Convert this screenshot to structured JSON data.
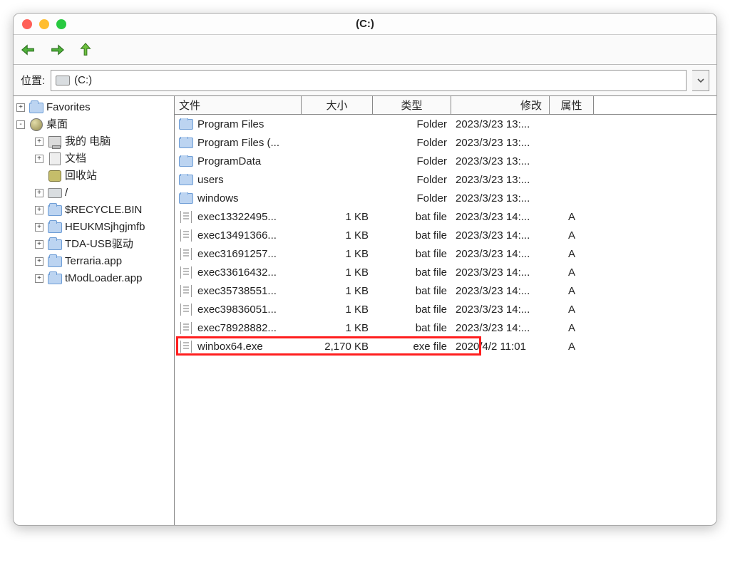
{
  "window": {
    "title": "(C:)"
  },
  "toolbar": {
    "back_icon": "arrow-left-icon",
    "forward_icon": "arrow-right-icon",
    "up_icon": "arrow-up-icon"
  },
  "location": {
    "label": "位置:",
    "path": "(C:)"
  },
  "tree": {
    "favorites": {
      "label": "Favorites",
      "expander": "+"
    },
    "desktop": {
      "label": "桌面",
      "expander": "-",
      "children": [
        {
          "kind": "pc",
          "label": "我的 电脑",
          "expander": "+"
        },
        {
          "kind": "doc",
          "label": "文档",
          "expander": "+"
        },
        {
          "kind": "bin",
          "label": "回收站",
          "expander": ""
        },
        {
          "kind": "drive",
          "label": "/",
          "expander": "+"
        },
        {
          "kind": "folder",
          "label": "$RECYCLE.BIN",
          "expander": "+"
        },
        {
          "kind": "folder",
          "label": "HEUKMSjhgjmfb",
          "expander": "+"
        },
        {
          "kind": "folder",
          "label": "TDA-USB驱动",
          "expander": "+"
        },
        {
          "kind": "folder",
          "label": "Terraria.app",
          "expander": "+"
        },
        {
          "kind": "folder",
          "label": "tModLoader.app",
          "expander": "+"
        }
      ]
    }
  },
  "columns": {
    "name": "文件",
    "size": "大小",
    "type": "类型",
    "mod": "修改",
    "attr": "属性"
  },
  "files": [
    {
      "icon": "folder",
      "name": "Program Files",
      "size": "",
      "type": "Folder",
      "mod": "2023/3/23 13:...",
      "attr": "",
      "hl": false
    },
    {
      "icon": "folder",
      "name": "Program Files (...",
      "size": "",
      "type": "Folder",
      "mod": "2023/3/23 13:...",
      "attr": "",
      "hl": false
    },
    {
      "icon": "folder",
      "name": "ProgramData",
      "size": "",
      "type": "Folder",
      "mod": "2023/3/23 13:...",
      "attr": "",
      "hl": false
    },
    {
      "icon": "folder",
      "name": "users",
      "size": "",
      "type": "Folder",
      "mod": "2023/3/23 13:...",
      "attr": "",
      "hl": false
    },
    {
      "icon": "folder",
      "name": "windows",
      "size": "",
      "type": "Folder",
      "mod": "2023/3/23 13:...",
      "attr": "",
      "hl": false
    },
    {
      "icon": "file",
      "name": "exec13322495...",
      "size": "1 KB",
      "type": "bat file",
      "mod": "2023/3/23 14:...",
      "attr": "A",
      "hl": false
    },
    {
      "icon": "file",
      "name": "exec13491366...",
      "size": "1 KB",
      "type": "bat file",
      "mod": "2023/3/23 14:...",
      "attr": "A",
      "hl": false
    },
    {
      "icon": "file",
      "name": "exec31691257...",
      "size": "1 KB",
      "type": "bat file",
      "mod": "2023/3/23 14:...",
      "attr": "A",
      "hl": false
    },
    {
      "icon": "file",
      "name": "exec33616432...",
      "size": "1 KB",
      "type": "bat file",
      "mod": "2023/3/23 14:...",
      "attr": "A",
      "hl": false
    },
    {
      "icon": "file",
      "name": "exec35738551...",
      "size": "1 KB",
      "type": "bat file",
      "mod": "2023/3/23 14:...",
      "attr": "A",
      "hl": false
    },
    {
      "icon": "file",
      "name": "exec39836051...",
      "size": "1 KB",
      "type": "bat file",
      "mod": "2023/3/23 14:...",
      "attr": "A",
      "hl": false
    },
    {
      "icon": "file",
      "name": "exec78928882...",
      "size": "1 KB",
      "type": "bat file",
      "mod": "2023/3/23 14:...",
      "attr": "A",
      "hl": false
    },
    {
      "icon": "file",
      "name": "winbox64.exe",
      "size": "2,170 KB",
      "type": "exe file",
      "mod": "2020/4/2 11:01",
      "attr": "A",
      "hl": true
    }
  ]
}
